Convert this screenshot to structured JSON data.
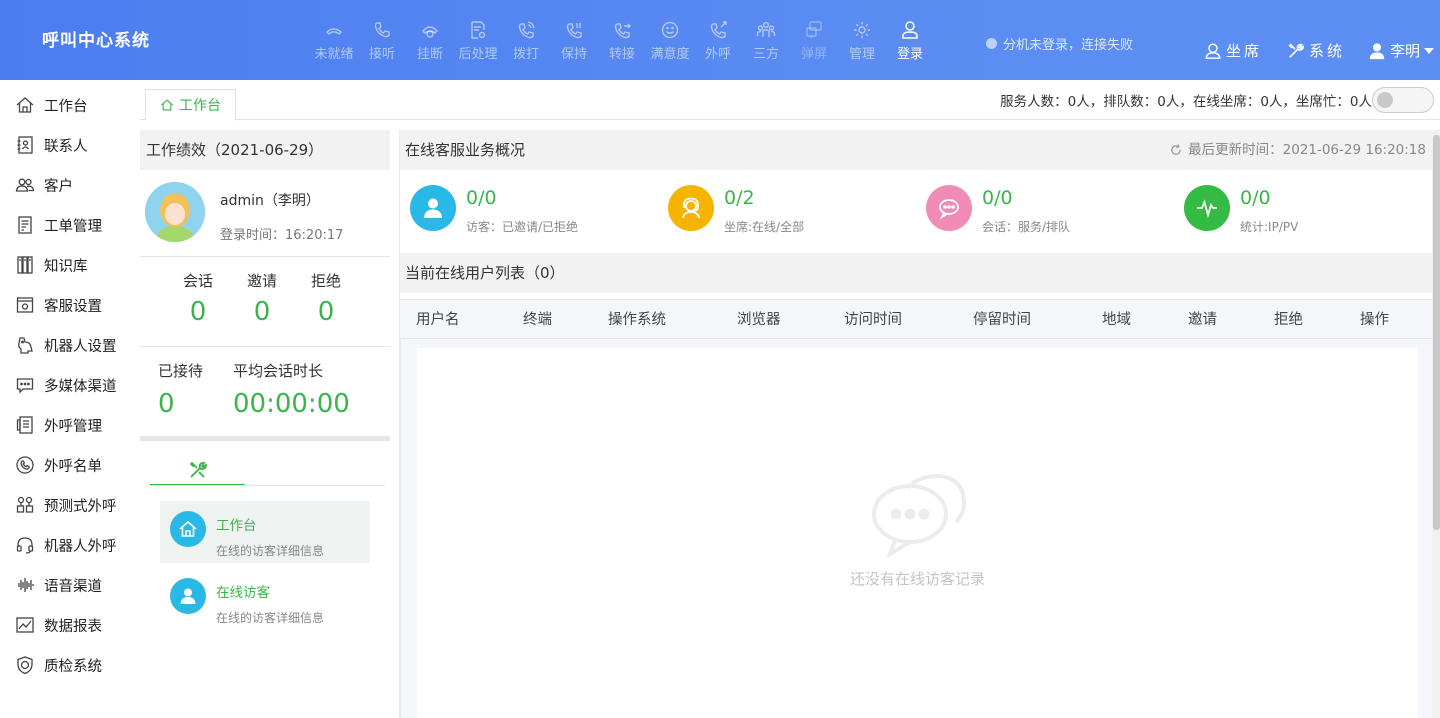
{
  "app_title": "呼叫中心系统",
  "toolbar": [
    {
      "icon": "handset-idle-icon",
      "label": "未就绪",
      "state": "dim"
    },
    {
      "icon": "phone-icon",
      "label": "接听",
      "state": "dim"
    },
    {
      "icon": "phone-hangup-icon",
      "label": "挂断",
      "state": "dim"
    },
    {
      "icon": "document-gear-icon",
      "label": "后处理",
      "state": "dim"
    },
    {
      "icon": "phone-dial-icon",
      "label": "拨打",
      "state": "dim"
    },
    {
      "icon": "phone-hold-icon",
      "label": "保持",
      "state": "dim"
    },
    {
      "icon": "phone-transfer-icon",
      "label": "转接",
      "state": "dim"
    },
    {
      "icon": "smiley-icon",
      "label": "满意度",
      "state": "dim"
    },
    {
      "icon": "phone-outgoing-icon",
      "label": "外呼",
      "state": "dim"
    },
    {
      "icon": "three-people-icon",
      "label": "三方",
      "state": "dim"
    },
    {
      "icon": "popup-screen-icon",
      "label": "弹屏",
      "state": "faint"
    },
    {
      "icon": "gear-icon",
      "label": "管理",
      "state": "dim"
    },
    {
      "icon": "user-login-icon",
      "label": "登录",
      "state": "active"
    }
  ],
  "extension_status": "分机未登录，连接失败",
  "top_right": {
    "seat_label": "坐席",
    "system_label": "系统",
    "user_label": "李明"
  },
  "sidebar": [
    {
      "icon": "home-icon",
      "label": "工作台"
    },
    {
      "icon": "contacts-icon",
      "label": "联系人"
    },
    {
      "icon": "customers-icon",
      "label": "客户"
    },
    {
      "icon": "work-order-icon",
      "label": "工单管理"
    },
    {
      "icon": "knowledge-base-icon",
      "label": "知识库"
    },
    {
      "icon": "service-settings-icon",
      "label": "客服设置"
    },
    {
      "icon": "robot-settings-icon",
      "label": "机器人设置"
    },
    {
      "icon": "chat-channel-icon",
      "label": "多媒体渠道"
    },
    {
      "icon": "outbound-manage-icon",
      "label": "外呼管理"
    },
    {
      "icon": "phone-list-icon",
      "label": "外呼名单"
    },
    {
      "icon": "predictive-call-icon",
      "label": "预测式外呼"
    },
    {
      "icon": "headset-icon",
      "label": "机器人外呼"
    },
    {
      "icon": "voice-wave-icon",
      "label": "语音渠道"
    },
    {
      "icon": "report-chart-icon",
      "label": "数据报表"
    },
    {
      "icon": "quality-shield-icon",
      "label": "质检系统"
    }
  ],
  "tab": {
    "label": "工作台"
  },
  "stats_line": "服务人数：0人，排队数：0人，在线坐席：0人，坐席忙：0人",
  "performance": {
    "title": "工作绩效（2021-06-29）",
    "user": "admin（李明）",
    "login_time": "登录时间：16:20:17",
    "session_label": "会话",
    "session_value": "0",
    "invite_label": "邀请",
    "invite_value": "0",
    "reject_label": "拒绝",
    "reject_value": "0",
    "received_label": "已接待",
    "received_value": "0",
    "avg_label": "平均会话时长",
    "avg_value": "00:00:00"
  },
  "quick_links": [
    {
      "icon": "home-icon",
      "title": "工作台",
      "desc": "在线的访客详细信息"
    },
    {
      "icon": "visitor-icon",
      "title": "在线访客",
      "desc": "在线的访客详细信息"
    }
  ],
  "overview": {
    "title": "在线客服业务概况",
    "updated": "最后更新时间：2021-06-29 16:20:18",
    "kpis": [
      {
        "value": "0/0",
        "label": "访客：已邀请/已拒绝",
        "color": "#2ab8e6",
        "icon": "visitor-icon"
      },
      {
        "value": "0/2",
        "label": "坐席:在线/全部",
        "color": "#f5b400",
        "icon": "agent-headset-icon"
      },
      {
        "value": "0/0",
        "label": "会话：服务/排队",
        "color": "#f08bb8",
        "icon": "chat-bubble-icon"
      },
      {
        "value": "0/0",
        "label": "统计:IP/PV",
        "color": "#33bb44",
        "icon": "pulse-icon"
      }
    ]
  },
  "user_list": {
    "title": "当前在线用户列表（0）",
    "columns": [
      "用户名",
      "终端",
      "操作系统",
      "浏览器",
      "访问时间",
      "停留时间",
      "地域",
      "邀请",
      "拒绝",
      "操作"
    ],
    "empty_text": "还没有在线访客记录"
  },
  "colors": {
    "accent": "#3ab54a",
    "topbar": "#5a8cf2"
  }
}
